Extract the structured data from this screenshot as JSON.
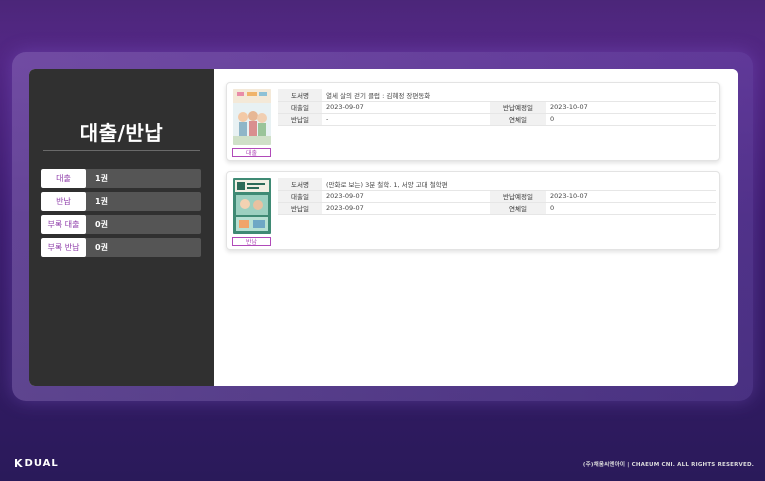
{
  "sidebar": {
    "title": "대출/반납",
    "stats": [
      {
        "label": "대출",
        "value": "1권"
      },
      {
        "label": "반납",
        "value": "1권"
      },
      {
        "label": "부록 대출",
        "value": "0권"
      },
      {
        "label": "부록 반납",
        "value": "0권"
      }
    ]
  },
  "field_labels": {
    "title": "도서명",
    "loan_date": "대출일",
    "due_date": "반납예정일",
    "return_date": "반납일",
    "overdue_days": "연체일"
  },
  "books": [
    {
      "title": "열세 살의 걷기 클럽 : 김혜정 장편동화",
      "loan_date": "2023-09-07",
      "due_date": "2023-10-07",
      "return_date": "-",
      "overdue_days": "0",
      "status": "대출"
    },
    {
      "title": "(만화로 보는) 3분 철학. 1, 서양 고대 철학편",
      "loan_date": "2023-09-07",
      "due_date": "2023-10-07",
      "return_date": "2023-09-07",
      "overdue_days": "0",
      "status": "반납"
    }
  ],
  "footer": {
    "logo_k": "K",
    "logo_rest": "DUAL",
    "copyright": "(주)채움씨엔아이  |   CHAEUM CNI. ALL RIGHTS RESERVED."
  },
  "colors": {
    "accent": "#b04ab9",
    "sidebar_bg": "#303030",
    "background_top": "#5a2a8c",
    "background_bottom": "#2a1a5a"
  }
}
